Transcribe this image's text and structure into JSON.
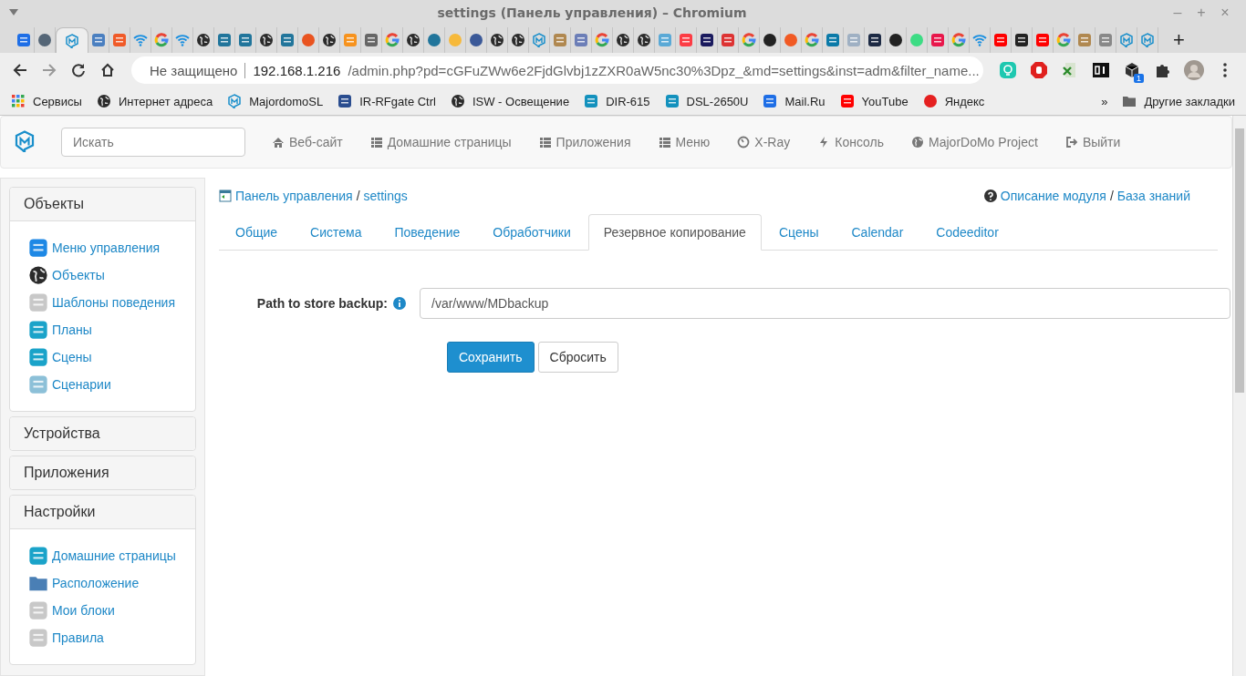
{
  "window": {
    "title": "settings (Панель управления) – Chromium",
    "controls": [
      "–",
      "+",
      "×"
    ]
  },
  "tabs": [
    {
      "selected": false
    },
    {
      "selected": false
    },
    {
      "selected": true
    },
    {
      "selected": false
    },
    {
      "selected": false
    },
    {
      "selected": false
    },
    {
      "selected": false
    },
    {
      "selected": false
    },
    {
      "selected": false
    },
    {
      "selected": false
    },
    {
      "selected": false
    },
    {
      "selected": false
    },
    {
      "selected": false
    },
    {
      "selected": false
    },
    {
      "selected": false
    },
    {
      "selected": false
    },
    {
      "selected": false
    },
    {
      "selected": false
    },
    {
      "selected": false
    },
    {
      "selected": false
    },
    {
      "selected": false
    },
    {
      "selected": false
    },
    {
      "selected": false
    },
    {
      "selected": false
    },
    {
      "selected": false
    },
    {
      "selected": false
    },
    {
      "selected": false
    },
    {
      "selected": false
    },
    {
      "selected": false
    },
    {
      "selected": false
    },
    {
      "selected": false
    },
    {
      "selected": false
    },
    {
      "selected": false
    },
    {
      "selected": false
    },
    {
      "selected": false
    },
    {
      "selected": false
    },
    {
      "selected": false
    },
    {
      "selected": false
    },
    {
      "selected": false
    },
    {
      "selected": false
    },
    {
      "selected": false
    },
    {
      "selected": false
    },
    {
      "selected": false
    },
    {
      "selected": false
    },
    {
      "selected": false
    },
    {
      "selected": false
    },
    {
      "selected": false
    },
    {
      "selected": false
    },
    {
      "selected": false
    },
    {
      "selected": false
    },
    {
      "selected": false
    },
    {
      "selected": false
    },
    {
      "selected": false
    },
    {
      "selected": false
    }
  ],
  "new_tab": "+",
  "toolbar": {
    "forward_disabled": true,
    "security": "Не защищено",
    "url_host": "192.168.1.216",
    "url_rest": "/admin.php?pd=cGFuZWw6e2FjdGlvbj1zZXR0aW5nc30%3Dpz_&md=settings&inst=adm&filter_name...",
    "extension_badge": "1"
  },
  "bookmarks": {
    "items": [
      "Сервисы",
      "Интернет адреса",
      "MajordomoSL",
      "IR-RFgate Ctrl",
      "ISW - Освещение",
      "DIR-615",
      "DSL-2650U",
      "Mail.Ru",
      "YouTube",
      "Яндекс"
    ],
    "overflow": "»",
    "other": "Другие закладки"
  },
  "navbar": {
    "search": {
      "placeholder": "Искать"
    },
    "links": [
      "Веб-сайт",
      "Домашние страницы",
      "Приложения",
      "Меню",
      "X-Ray",
      "Консоль",
      "MajorDoMo Project",
      "Выйти"
    ]
  },
  "sidebar": [
    {
      "title": "Объекты",
      "expanded": true,
      "items": [
        "Меню управления",
        "Объекты",
        "Шаблоны поведения",
        "Планы",
        "Сцены",
        "Сценарии"
      ]
    },
    {
      "title": "Устройства",
      "expanded": false
    },
    {
      "title": "Приложения",
      "expanded": false
    },
    {
      "title": "Настройки",
      "expanded": true,
      "items": [
        "Домашние страницы",
        "Расположение",
        "Мои блоки",
        "Правила"
      ]
    }
  ],
  "breadcrumb": {
    "items": [
      "Панель управления",
      "settings"
    ],
    "separator": "/"
  },
  "help": {
    "items": [
      "Описание модуля",
      "База знаний"
    ],
    "separator": "/"
  },
  "module_tabs": [
    {
      "label": "Общие",
      "selected": false
    },
    {
      "label": "Система",
      "selected": false
    },
    {
      "label": "Поведение",
      "selected": false
    },
    {
      "label": "Обработчики",
      "selected": false
    },
    {
      "label": "Резервное копирование",
      "selected": true
    },
    {
      "label": "Сцены",
      "selected": false
    },
    {
      "label": "Calendar",
      "selected": false
    },
    {
      "label": "Codeeditor",
      "selected": false
    }
  ],
  "form": {
    "label": "Path to store backup:",
    "value": "/var/www/MDbackup",
    "buttons": [
      {
        "label": "Сохранить",
        "kind": "primary"
      },
      {
        "label": "Сбросить",
        "kind": "default"
      }
    ]
  }
}
